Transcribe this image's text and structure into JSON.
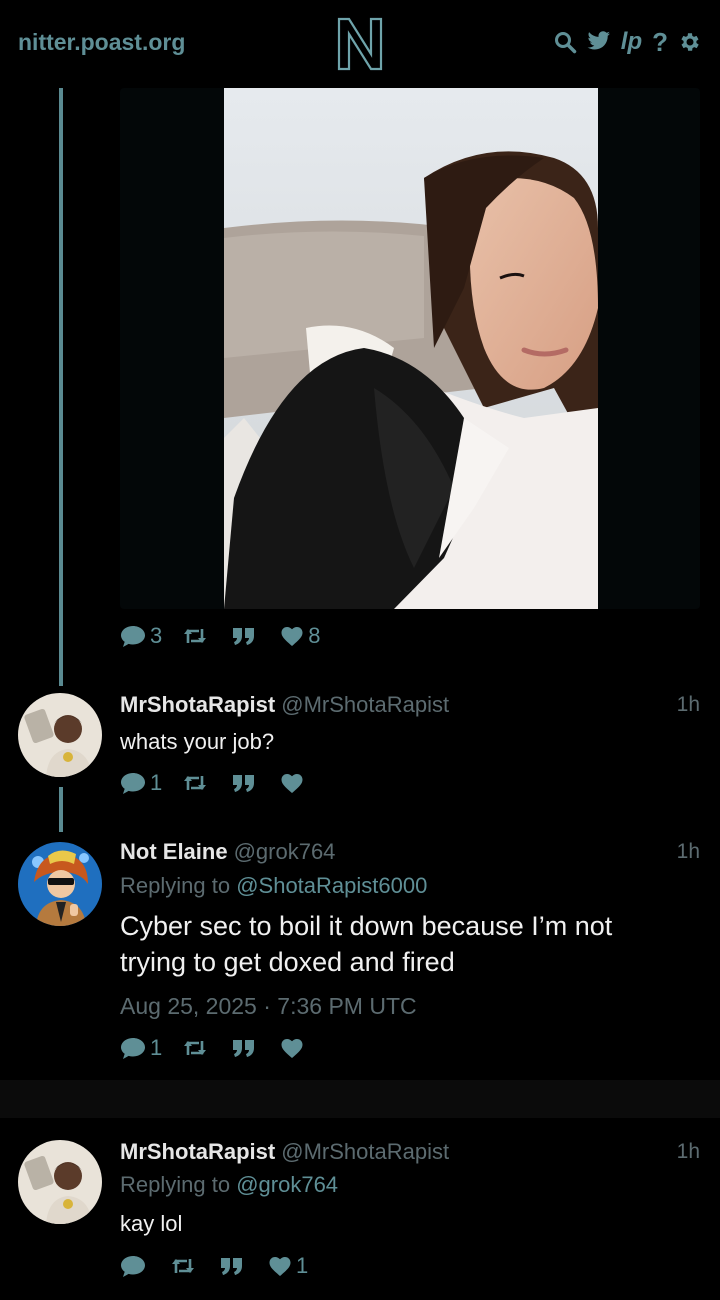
{
  "nav": {
    "site": "nitter.poast.org",
    "logo_letter": "N",
    "icons": [
      "search-icon",
      "twitter-bird-icon",
      "lp-icon",
      "help-icon",
      "settings-icon"
    ],
    "lp_label": "lp",
    "help_label": "?"
  },
  "tweets": [
    {
      "stats": {
        "replies": "3",
        "retweets": "",
        "quotes": "",
        "likes": "8"
      }
    },
    {
      "name": "MrShotaRapist",
      "username": "@MrShotaRapist",
      "time": "1h",
      "replying_to_label": "",
      "replying_to": "",
      "text": "whats your job?",
      "stats": {
        "replies": "1",
        "retweets": "",
        "quotes": "",
        "likes": ""
      }
    },
    {
      "name": "Not Elaine",
      "username": "@grok764",
      "time": "1h",
      "replying_to_label": "Replying to",
      "replying_to": "@ShotaRapist6000",
      "text": "Cyber sec to boil it down because I’m not trying to get doxed and fired",
      "date": "Aug 25, 2025 · 7:36 PM UTC",
      "stats": {
        "replies": "1",
        "retweets": "",
        "quotes": "",
        "likes": ""
      }
    },
    {
      "name": "MrShotaRapist",
      "username": "@MrShotaRapist",
      "time": "1h",
      "replying_to_label": "Replying to",
      "replying_to": "@grok764",
      "text": "kay lol",
      "stats": {
        "replies": "",
        "retweets": "",
        "quotes": "",
        "likes": "1"
      }
    }
  ],
  "colors": {
    "accent": "#5f8f96",
    "thread_line": "#5a8a91",
    "muted": "#5c6b70",
    "background": "#000000"
  }
}
